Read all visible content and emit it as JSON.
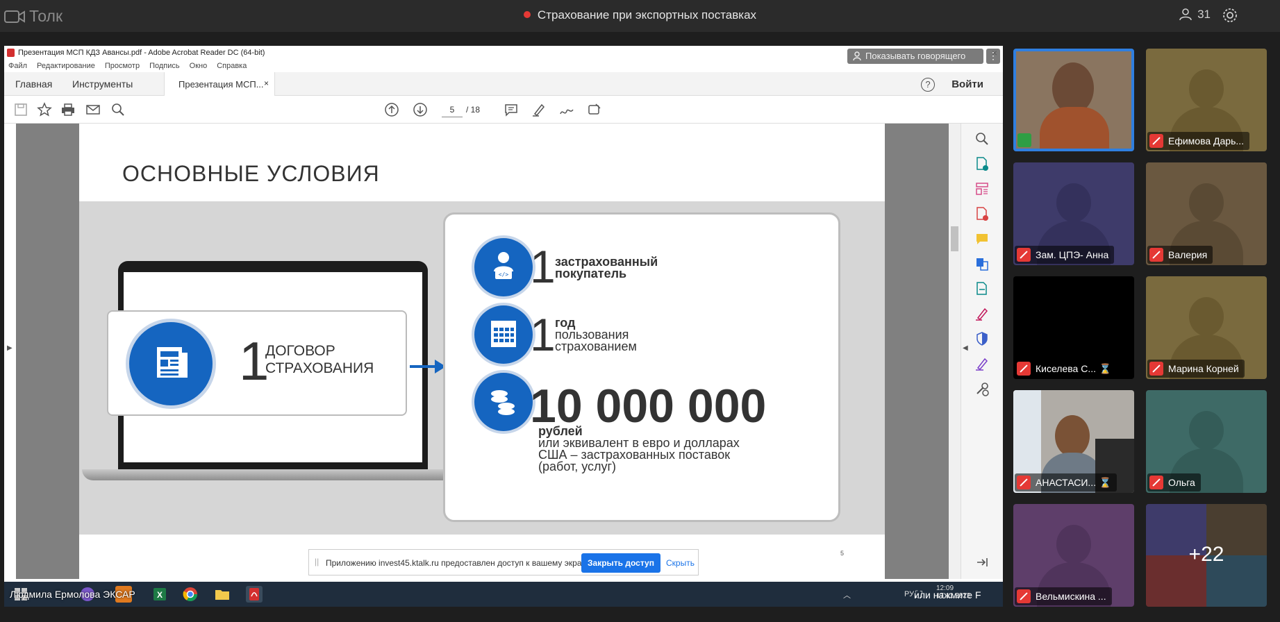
{
  "topbar": {
    "app_name": "Толк",
    "meeting_title": "Страхование при экспортных поставках",
    "participants_count": "31"
  },
  "acrobat": {
    "window_title": "Презентация МСП КДЗ Авансы.pdf - Adobe Acrobat Reader DC (64-bit)",
    "menu": [
      "Файл",
      "Редактирование",
      "Просмотр",
      "Подпись",
      "Окно",
      "Справка"
    ],
    "tab_home": "Главная",
    "tab_tools": "Инструменты",
    "tab_doc": "Презентация МСП...",
    "login": "Войти",
    "page_current": "5",
    "page_total": "/ 18",
    "show_speaker": "Показывать говорящего"
  },
  "slide": {
    "title": "ОСНОВНЫЕ УСЛОВИЯ",
    "contract_num": "1",
    "contract_line1": "ДОГОВОР",
    "contract_line2": "СТРАХОВАНИЯ",
    "cond1_num": "1",
    "cond1_line1": "застрахованный",
    "cond1_line2": "покупатель",
    "cond2_num": "1",
    "cond2_line1": "год",
    "cond2_line2": "пользования",
    "cond2_line3": "страхованием",
    "cond3_num": "10 000 000",
    "cond3_line1": "рублей",
    "cond3_line2": "или эквивалент в евро и долларах",
    "cond3_line3": "США – застрахованных поставок",
    "cond3_line4": "(работ, услуг)",
    "page_no": "5"
  },
  "share_notice": {
    "text": "Приложению invest45.ktalk.ru предоставлен доступ к вашему экрану.",
    "close_btn": "Закрыть доступ",
    "hide_link": "Скрыть"
  },
  "taskbar": {
    "presenter": "Людмила Ермолова ЭКСАР",
    "fullscreen_hint": "или нажмите F",
    "time": "12:09",
    "date": "17.11.2022",
    "lang": "РУ"
  },
  "tiles": [
    {
      "name": "",
      "bg": "#8a7560"
    },
    {
      "name": "Ефимова Дарь...",
      "bg": "#7a6a3e"
    },
    {
      "name": "Зам. ЦПЭ- Анна",
      "bg": "#3e3b6a"
    },
    {
      "name": "Валерия",
      "bg": "#6a5840"
    },
    {
      "name": "Киселева С...",
      "bg": "#000000"
    },
    {
      "name": "Марина Корней",
      "bg": "#7a6a3e"
    },
    {
      "name": "АНАСТАСИ...",
      "bg": "#b0aca6"
    },
    {
      "name": "Ольга",
      "bg": "#3e6a66"
    },
    {
      "name": "Вельмискина ...",
      "bg": "#5e3e6a"
    }
  ],
  "more_participants": "+22"
}
